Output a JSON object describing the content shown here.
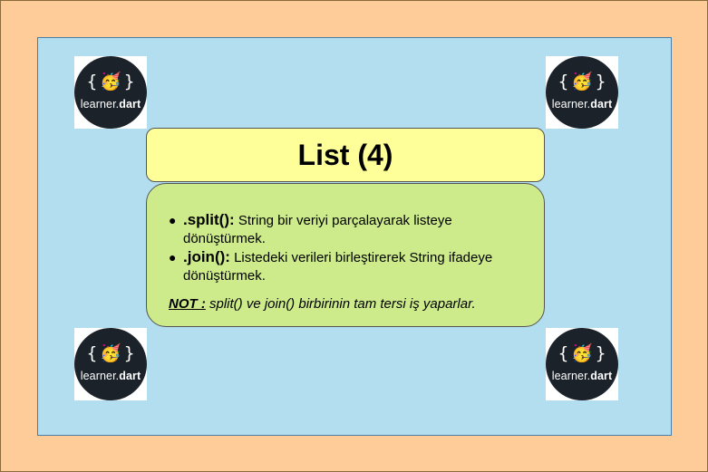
{
  "logo": {
    "brace_open": "{",
    "brace_close": "}",
    "face": "🥳",
    "brand_prefix": "learner.",
    "brand_suffix": "dart"
  },
  "title": "List (4)",
  "items": [
    {
      "term": ".split():",
      "text": " String bir veriyi parçalayarak listeye dönüştürmek."
    },
    {
      "term": ".join():",
      "text": " Listedeki verileri birleştirerek String ifadeye dönüştürmek."
    }
  ],
  "note": {
    "label": "NOT :",
    "text": " split() ve join() birbirinin tam tersi iş yaparlar."
  },
  "colors": {
    "outer_bg": "#fdcc99",
    "panel_bg": "#b2def0",
    "title_bg": "#ffff99",
    "content_bg": "#cdeb8b",
    "logo_bg": "#1b222a"
  }
}
